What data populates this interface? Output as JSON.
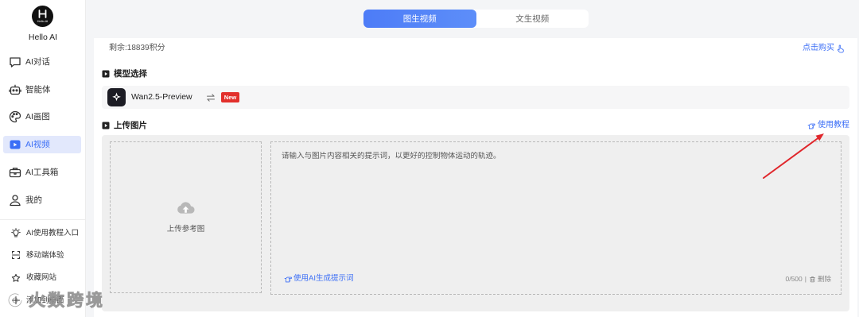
{
  "app": {
    "name": "Hello AI",
    "logo_text": "Hello AI"
  },
  "colors": {
    "accent": "#3b6ef6",
    "active_bg": "#e2e8fc",
    "badge": "#e2302c",
    "annotation": "#e0262b",
    "panel": "#efefef"
  },
  "sidebar": {
    "main_items": [
      {
        "label": "AI对话",
        "icon": "chat-icon",
        "active": false
      },
      {
        "label": "智能体",
        "icon": "robot-icon",
        "active": false
      },
      {
        "label": "AI画图",
        "icon": "palette-icon",
        "active": false
      },
      {
        "label": "AI视频",
        "icon": "video-icon",
        "active": true
      },
      {
        "label": "AI工具箱",
        "icon": "toolbox-icon",
        "active": false
      },
      {
        "label": "我的",
        "icon": "user-icon",
        "active": false
      }
    ],
    "secondary_items": [
      {
        "label": "AI使用教程入口",
        "icon": "bulb-icon"
      },
      {
        "label": "移动端体验",
        "icon": "scan-icon"
      },
      {
        "label": "收藏网站",
        "icon": "star-icon"
      },
      {
        "label": "添加到桌面",
        "icon": "plus-icon"
      }
    ]
  },
  "tabs": [
    {
      "label": "图生视频",
      "active": true
    },
    {
      "label": "文生视频",
      "active": false
    }
  ],
  "credits": {
    "balance_text": "剩余:18839积分",
    "buy_label": "点击购买",
    "buy_icon": "hand-pointer-icon"
  },
  "model_section": {
    "title": "模型选择",
    "title_icon": "film-icon",
    "model_name": "Wan2.5-Preview",
    "model_icon": "model-logo-icon",
    "switch_icon": "swap-icon",
    "badge": "New"
  },
  "upload_section": {
    "title": "上传图片",
    "title_icon": "film-icon",
    "tutorial_label": "使用教程",
    "tutorial_icon": "hand-point-right-icon",
    "upload_label": "上传参考图",
    "upload_icon": "cloud-upload-icon",
    "prompt_placeholder": "请输入与图片内容相关的提示词，以更好的控制物体运动的轨迹。",
    "ai_prompt_label": "使用AI生成提示词",
    "char_count": "0/500",
    "separator": "|",
    "delete_label": "删除",
    "delete_icon": "trash-icon"
  },
  "watermark": {
    "text": "火数跨境"
  }
}
